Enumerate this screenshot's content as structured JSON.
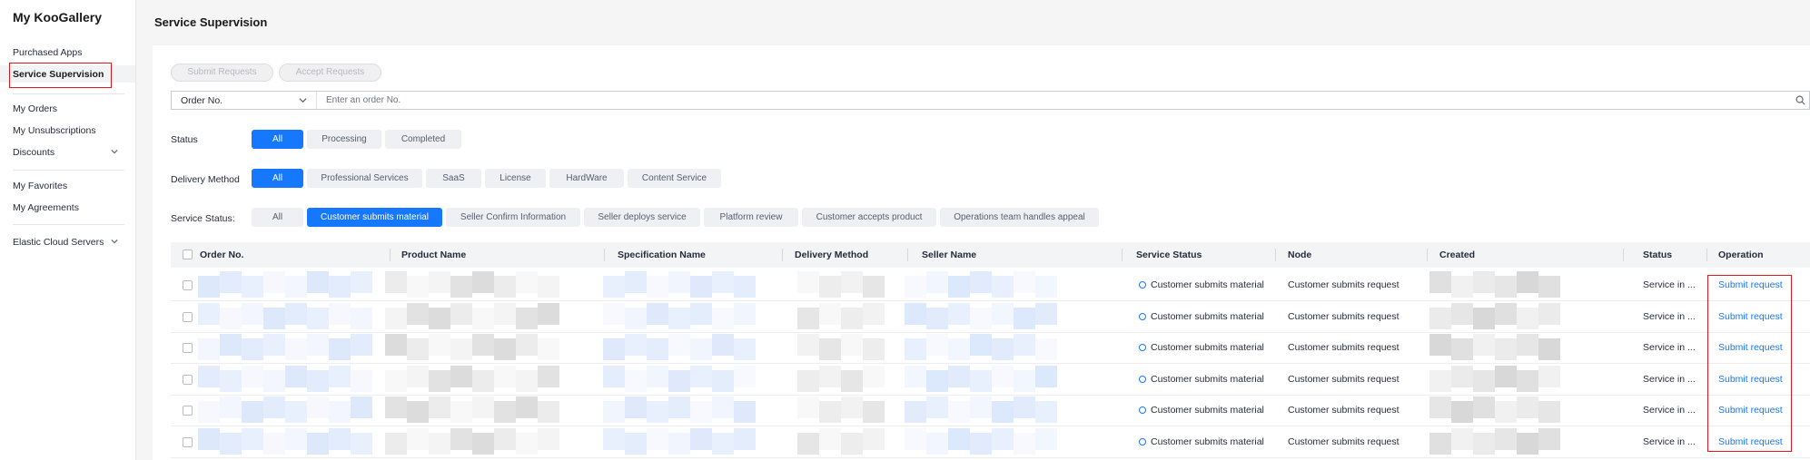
{
  "sidebar": {
    "brand": "My KooGallery",
    "items": [
      {
        "label": "Purchased Apps"
      },
      {
        "label": "Service Supervision"
      },
      {
        "label": "My Orders"
      },
      {
        "label": "My Unsubscriptions"
      },
      {
        "label": "Discounts"
      },
      {
        "label": "My Favorites"
      },
      {
        "label": "My Agreements"
      },
      {
        "label": "Elastic Cloud Servers"
      }
    ],
    "active": "Service Supervision"
  },
  "page": {
    "title": "Service Supervision"
  },
  "toolbar": {
    "submit_requests": "Submit Requests",
    "accept_requests": "Accept Requests"
  },
  "search": {
    "field": "Order No.",
    "placeholder": "Enter an order No."
  },
  "filters": {
    "status": {
      "label": "Status",
      "options": [
        "All",
        "Processing",
        "Completed"
      ],
      "selected": "All"
    },
    "delivery_method": {
      "label": "Delivery Method",
      "options": [
        "All",
        "Professional Services",
        "SaaS",
        "License",
        "HardWare",
        "Content Service"
      ],
      "selected": "All"
    },
    "service_status": {
      "label": "Service Status:",
      "options": [
        "All",
        "Customer submits material",
        "Seller Confirm Information",
        "Seller deploys service",
        "Platform review",
        "Customer accepts product",
        "Operations team handles appeal"
      ],
      "selected": "Customer submits material"
    }
  },
  "table": {
    "columns": [
      "Order No.",
      "Product Name",
      "Specification Name",
      "Delivery Method",
      "Seller Name",
      "Service Status",
      "Node",
      "Created",
      "Status",
      "Operation"
    ],
    "rows": [
      {
        "service_status": "Customer submits material",
        "node": "Customer submits request",
        "status": "Service in ...",
        "operation": "Submit request"
      },
      {
        "service_status": "Customer submits material",
        "node": "Customer submits request",
        "status": "Service in ...",
        "operation": "Submit request"
      },
      {
        "service_status": "Customer submits material",
        "node": "Customer submits request",
        "status": "Service in ...",
        "operation": "Submit request"
      },
      {
        "service_status": "Customer submits material",
        "node": "Customer submits request",
        "status": "Service in ...",
        "operation": "Submit request"
      },
      {
        "service_status": "Customer submits material",
        "node": "Customer submits request",
        "status": "Service in ...",
        "operation": "Submit request"
      },
      {
        "service_status": "Customer submits material",
        "node": "Customer submits request",
        "status": "Service in ...",
        "operation": "Submit request"
      }
    ]
  },
  "colors": {
    "accent": "#1677ff",
    "highlight": "#e0191e"
  },
  "icons": {
    "chevron": "chevron-down-icon",
    "search": "search-icon",
    "status": "status-circle-icon"
  }
}
